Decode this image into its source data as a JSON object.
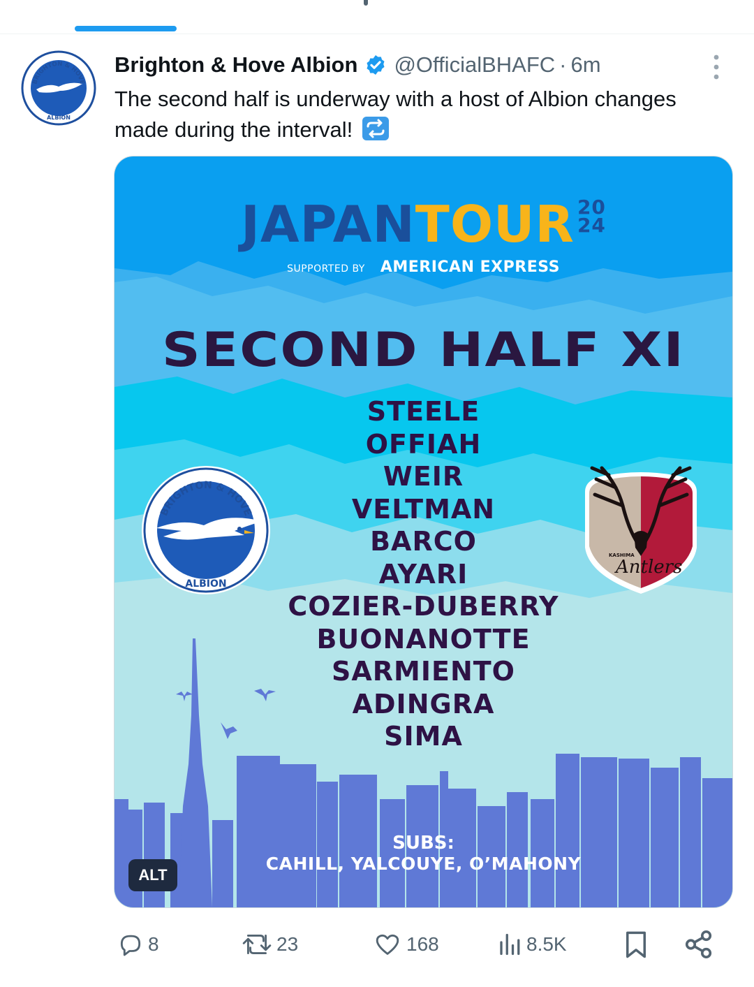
{
  "tweet": {
    "author_name": "Brighton & Hove Albion",
    "handle": "@OfficialBHAFC",
    "separator": "·",
    "time": "6m",
    "text": "The second half is underway with a host of Albion changes made during the interval!",
    "emoji": "repeat-button-emoji"
  },
  "avatar": {
    "ring_top": "BRIGHTON & HOVE",
    "ring_bottom": "ALBION"
  },
  "media": {
    "title_part1": "JAPAN",
    "title_part2": "TOUR",
    "title_year_top": "20",
    "title_year_bottom": "24",
    "supported_by": "SUPPORTED BY",
    "sponsor": "AMERICAN EXPRESS",
    "heading": "SECOND HALF XI",
    "players": [
      "STEELE",
      "OFFIAH",
      "WEIR",
      "VELTMAN",
      "BARCO",
      "AYARI",
      "COZIER-DUBERRY",
      "BUONANOTTE",
      "SARMIENTO",
      "ADINGRA",
      "SIMA"
    ],
    "subs_label": "SUBS:",
    "subs": "CAHILL, YALCOUYE, O’MAHONY",
    "alt_badge": "ALT",
    "bha_crest_top": "BRIGHTON & HOVE",
    "bha_crest_bottom": "ALBION",
    "kashima_small": "KASHIMA",
    "kashima_script": "Antlers"
  },
  "actions": {
    "replies": "8",
    "reposts": "23",
    "likes": "168",
    "views": "8.5K"
  },
  "colors": {
    "accent": "#1d9bf0",
    "secondary_text": "#536471",
    "sky_top": "#0a9ff0",
    "skyline": "#5f79d6",
    "player_text": "#2e1245"
  }
}
